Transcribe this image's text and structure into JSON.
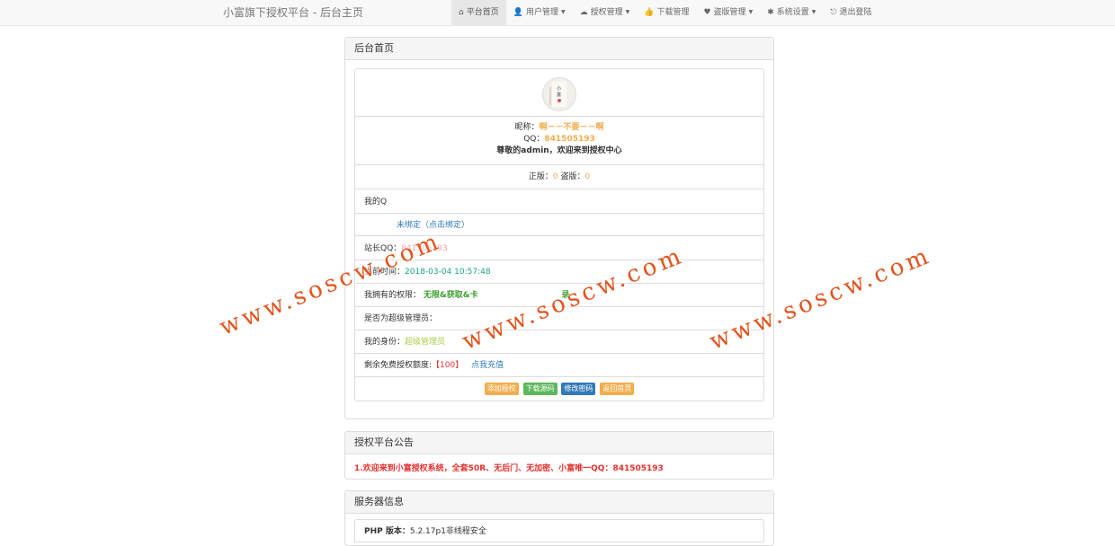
{
  "header": {
    "brand": "小富旗下授权平台 - 后台主页",
    "nav": [
      {
        "label": "平台首页",
        "icon": "home-icon",
        "glyph": "⌂",
        "dropdown": false,
        "active": true
      },
      {
        "label": "用户管理",
        "icon": "user-icon",
        "glyph": "👤",
        "dropdown": true,
        "active": false
      },
      {
        "label": "授权管理",
        "icon": "cloud-icon",
        "glyph": "☁",
        "dropdown": true,
        "active": false
      },
      {
        "label": "下载管理",
        "icon": "thumbs-up-icon",
        "glyph": "👍",
        "dropdown": false,
        "active": false
      },
      {
        "label": "盗版管理",
        "icon": "heart-icon",
        "glyph": "♥",
        "dropdown": true,
        "active": false
      },
      {
        "label": "系统设置",
        "icon": "asterisk-icon",
        "glyph": "✱",
        "dropdown": true,
        "active": false
      },
      {
        "label": "退出登陆",
        "icon": "logout-icon",
        "glyph": "⎋",
        "dropdown": false,
        "active": false
      }
    ]
  },
  "home_panel": {
    "title": "后台首页",
    "nickname_label": "昵称：",
    "nickname": "啊－－不要－－啊",
    "qq_label": "QQ：",
    "qq": "841505193",
    "welcome": "尊敬的admin，欢迎来到授权中心",
    "genuine_label": "正版：",
    "genuine": "0",
    "pirated_label": "盗版：",
    "pirated": "0",
    "row_myqq": "我的Q",
    "bind_text": "未绑定（点击绑定）",
    "site_qq_label": "站长QQ：",
    "site_qq": "841505193",
    "time_label": "当前时间：",
    "time": "2018-03-04 10:57:48",
    "perm_label": "我拥有的权限：",
    "perm_a": "无限&获取&卡",
    "perm_b": "录",
    "admin_label": "是否为超级管理员：",
    "identity_label": "我的身份：",
    "identity": "超级管理员",
    "quota_label": "剩余免费授权额度:",
    "quota": "【100】",
    "recharge": "点我充值",
    "btn_add": "添加授权",
    "btn_download": "下载源码",
    "btn_password": "修改密码",
    "btn_home": "返回首页"
  },
  "notice_panel": {
    "title": "授权平台公告",
    "text": "1.欢迎来到小富授权系统，全套50R、无后门、无加密、小富唯一QQ：841505193"
  },
  "server_panel": {
    "title": "服务器信息",
    "php_label": "PHP 版本：",
    "php_value": "5.2.17p1非线程安全"
  },
  "watermark": "www.soscw.com",
  "colors": {
    "accent_orange": "#f0ad4e",
    "success": "#5cb85c",
    "primary": "#337ab7",
    "danger": "#e3312e",
    "watermark": "#e2531c"
  }
}
